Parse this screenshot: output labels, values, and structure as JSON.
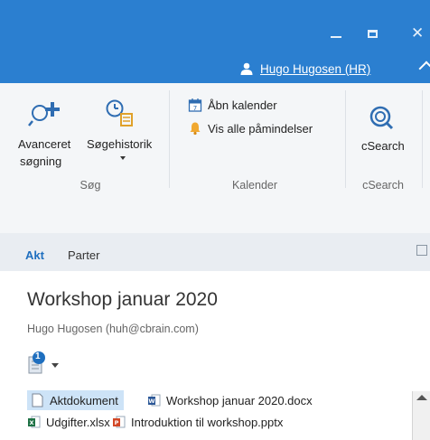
{
  "titlebar": {
    "user_name": "Hugo Hugosen (HR)"
  },
  "ribbon": {
    "search_group": {
      "advanced_label_line1": "Avanceret",
      "advanced_label_line2": "søgning",
      "history_label": "Søgehistorik",
      "group_label": "Søg"
    },
    "calendar_group": {
      "open_calendar": "Åbn kalender",
      "show_reminders": "Vis alle påmindelser",
      "group_label": "Kalender"
    },
    "csearch_group": {
      "button_label": "cSearch",
      "group_label": "cSearch"
    }
  },
  "tabs": {
    "akt": "Akt",
    "parter": "Parter"
  },
  "document": {
    "title": "Workshop januar 2020",
    "owner": "Hugo Hugosen (huh@cbrain.com)",
    "badge_count": "1"
  },
  "files": [
    {
      "name": "Aktdokument",
      "icon": "document-icon"
    },
    {
      "name": "Workshop januar 2020.docx",
      "icon": "word-icon"
    },
    {
      "name": "Udgifter.xlsx",
      "icon": "excel-icon"
    },
    {
      "name": "Introduktion til workshop.pptx",
      "icon": "powerpoint-icon"
    }
  ],
  "colors": {
    "titlebar": "#2b7fd0",
    "accent": "#1f6fbf",
    "selection": "#cde3f7"
  }
}
